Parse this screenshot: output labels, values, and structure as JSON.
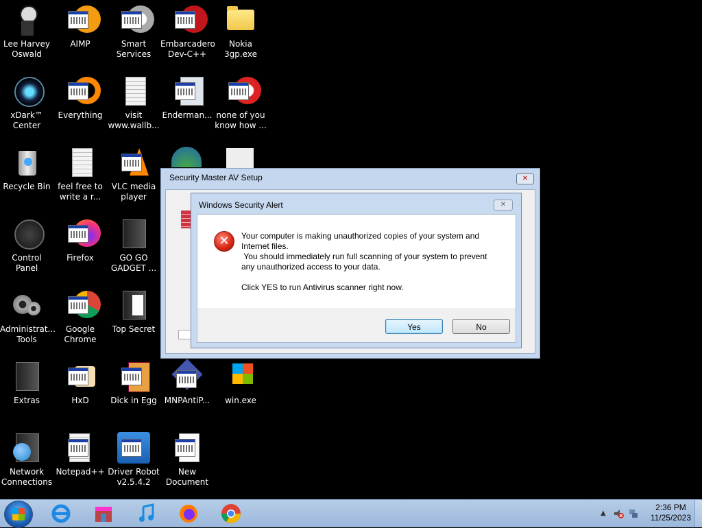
{
  "desktop": {
    "icons": [
      {
        "label": "Lee Harvey\nOswald",
        "name": "desktop-icon-lee-harvey-oswald"
      },
      {
        "label": "AIMP",
        "name": "desktop-icon-aimp"
      },
      {
        "label": "Smart\nServices",
        "name": "desktop-icon-smart-services"
      },
      {
        "label": "Embarcadero\nDev-C++",
        "name": "desktop-icon-embarcadero-dev-cpp"
      },
      {
        "label": "Nokia 3gp.exe",
        "name": "desktop-icon-nokia-3gp"
      },
      {
        "label": "xDark™\nCenter",
        "name": "desktop-icon-xdark-center"
      },
      {
        "label": "Everything",
        "name": "desktop-icon-everything"
      },
      {
        "label": "visit\nwww.wallb...",
        "name": "desktop-icon-visit-wallb"
      },
      {
        "label": "Enderman...",
        "name": "desktop-icon-enderman"
      },
      {
        "label": "none of you\nknow how ...",
        "name": "desktop-icon-none-of-you"
      },
      {
        "label": "Recycle Bin",
        "name": "desktop-icon-recycle-bin"
      },
      {
        "label": "feel free to\nwrite a r...",
        "name": "desktop-icon-feel-free"
      },
      {
        "label": "VLC media\nplayer",
        "name": "desktop-icon-vlc"
      },
      {
        "label": "Control Panel",
        "name": "desktop-icon-control-panel"
      },
      {
        "label": "Firefox",
        "name": "desktop-icon-firefox"
      },
      {
        "label": "GO GO\nGADGET ...",
        "name": "desktop-icon-go-go-gadget"
      },
      {
        "label": "Administrat...\nTools",
        "name": "desktop-icon-admin-tools"
      },
      {
        "label": "Google\nChrome",
        "name": "desktop-icon-google-chrome"
      },
      {
        "label": "Top Secret",
        "name": "desktop-icon-top-secret"
      },
      {
        "label": "Extras",
        "name": "desktop-icon-extras"
      },
      {
        "label": "HxD",
        "name": "desktop-icon-hxd"
      },
      {
        "label": "Dick in Egg",
        "name": "desktop-icon-dick-in-egg"
      },
      {
        "label": "MNPAntiP...",
        "name": "desktop-icon-mnpantip"
      },
      {
        "label": "win.exe",
        "name": "desktop-icon-win-exe"
      },
      {
        "label": "Network\nConnections",
        "name": "desktop-icon-network-connections"
      },
      {
        "label": "Notepad++",
        "name": "desktop-icon-notepadpp"
      },
      {
        "label": "Driver Robot\nv2.5.4.2",
        "name": "desktop-icon-driver-robot"
      },
      {
        "label": "New\nDocument",
        "name": "desktop-icon-new-document"
      }
    ]
  },
  "setup_window": {
    "title": "Security Master AV Setup",
    "close_icon": "close-icon"
  },
  "alert": {
    "title": "Windows Security Alert",
    "message": "Your computer is making unauthorized copies of your system and\nInternet files.\n You should immediately run full scanning of your system to prevent\nany unauthorized access to your data.\n\nClick YES to run Antivirus scanner right now.",
    "yes_label": "Yes",
    "no_label": "No",
    "error_icon": "error-icon"
  },
  "taskbar": {
    "pinned": [
      "internet-explorer-icon",
      "store-icon",
      "itunes-icon",
      "firefox-icon",
      "chrome-icon"
    ],
    "clock_time": "2:36 PM",
    "clock_date": "11/25/2023"
  },
  "colors": {
    "desktop_background": "#000000",
    "taskbar": "#a9c3e2",
    "error_red": "#d42410",
    "default_button_border": "#3c7fb1"
  }
}
